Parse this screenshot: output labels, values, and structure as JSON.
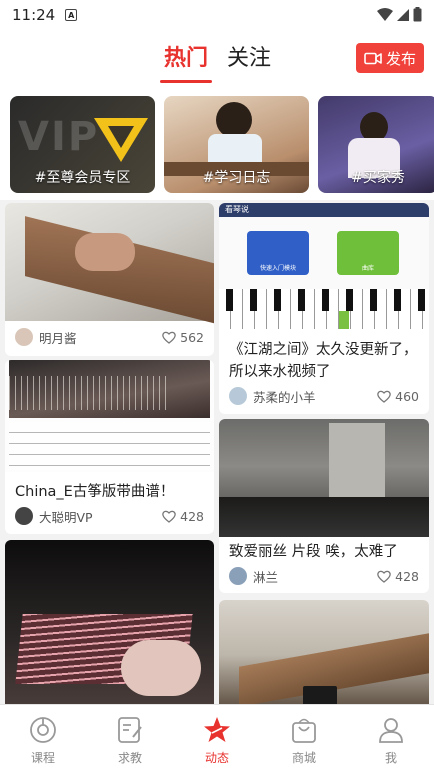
{
  "status_bar": {
    "time": "11:24",
    "notify_letter": "A"
  },
  "header": {
    "tabs": [
      {
        "label": "热门"
      },
      {
        "label": "关注"
      }
    ],
    "publish_label": "发布"
  },
  "topics": [
    {
      "label": "#至尊会员专区",
      "overlay": "VIP"
    },
    {
      "label": "#学习日志"
    },
    {
      "label": "#买家秀"
    }
  ],
  "feed": {
    "cards": [
      {
        "author": "明月酱",
        "likes": "562"
      },
      {
        "title": "《江湖之间》太久没更新了，所以来水视频了",
        "author": "苏柔的小羊",
        "likes": "460",
        "app_header": "看琴说",
        "app_buttons": [
          "快速入门模块",
          "曲库"
        ]
      },
      {
        "title": "China_E古筝版带曲谱！",
        "author": "大聪明VP",
        "likes": "428"
      },
      {
        "title": "致爱丽丝 片段 唉，太难了",
        "author": "淋兰",
        "likes": "428"
      }
    ]
  },
  "bottom_nav": [
    {
      "label": "课程",
      "icon": "course-icon"
    },
    {
      "label": "求教",
      "icon": "ask-icon"
    },
    {
      "label": "动态",
      "icon": "feed-star-icon"
    },
    {
      "label": "商城",
      "icon": "shop-bag-icon"
    },
    {
      "label": "我",
      "icon": "profile-icon"
    }
  ],
  "colors": {
    "accent": "#e8322e",
    "publish_bg": "#f0423a"
  }
}
